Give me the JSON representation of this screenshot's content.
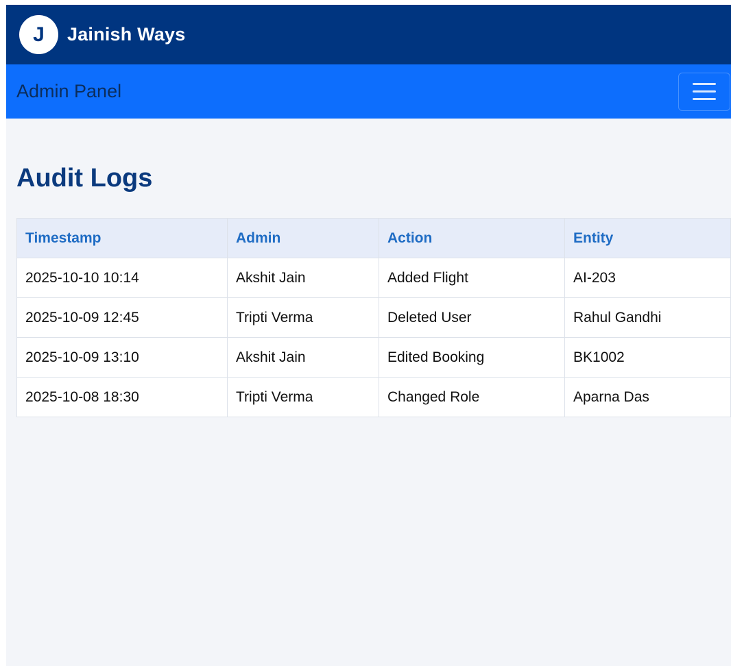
{
  "brand": {
    "logo_letter": "J",
    "name": "Jainish Ways"
  },
  "navbar": {
    "title": "Admin Panel",
    "menu_icon": "hamburger-menu-icon"
  },
  "page": {
    "title": "Audit Logs"
  },
  "table": {
    "headers": [
      "Timestamp",
      "Admin",
      "Action",
      "Entity"
    ],
    "rows": [
      [
        "2025-10-10 10:14",
        "Akshit Jain",
        "Added Flight",
        "AI-203"
      ],
      [
        "2025-10-09 12:45",
        "Tripti Verma",
        "Deleted User",
        "Rahul Gandhi"
      ],
      [
        "2025-10-09 13:10",
        "Akshit Jain",
        "Edited Booking",
        "BK1002"
      ],
      [
        "2025-10-08 18:30",
        "Tripti Verma",
        "Changed Role",
        "Aparna Das"
      ]
    ]
  },
  "colors": {
    "topbar": "#003580",
    "navbar": "#0d6efd",
    "page_bg": "#f3f5f9",
    "header_text": "#1f6cc4",
    "title_text": "#0b3a7e"
  }
}
